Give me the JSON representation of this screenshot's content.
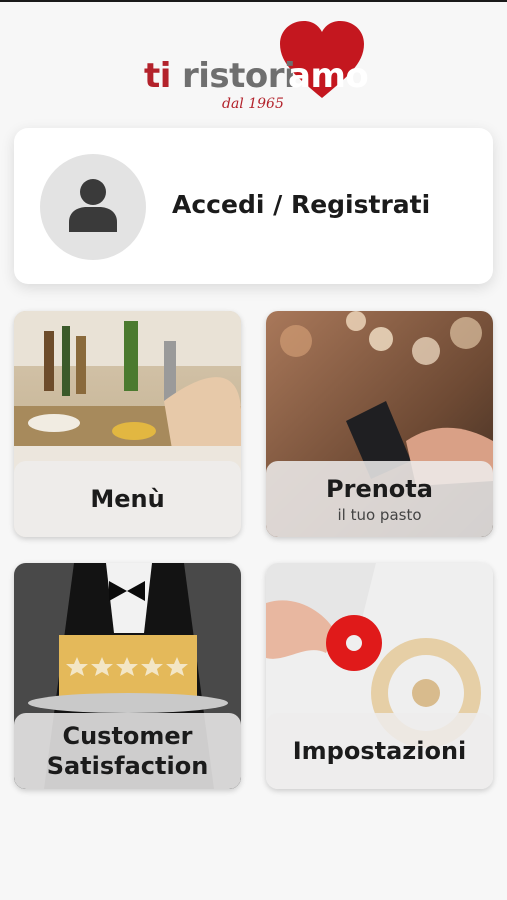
{
  "brand": {
    "logo_part1": "ti",
    "logo_part2": "ristori",
    "logo_part3": "amo",
    "since": "dal 1965",
    "color_red": "#b3222b"
  },
  "login": {
    "label": "Accedi / Registrati",
    "icon": "user-icon"
  },
  "tiles": [
    {
      "label": "Menù",
      "sublabel": ""
    },
    {
      "label": "Prenota",
      "sublabel": "il tuo pasto"
    },
    {
      "label": "Customer Satisfaction",
      "sublabel": "",
      "stars": 5
    },
    {
      "label": "Impostazioni",
      "sublabel": ""
    }
  ]
}
